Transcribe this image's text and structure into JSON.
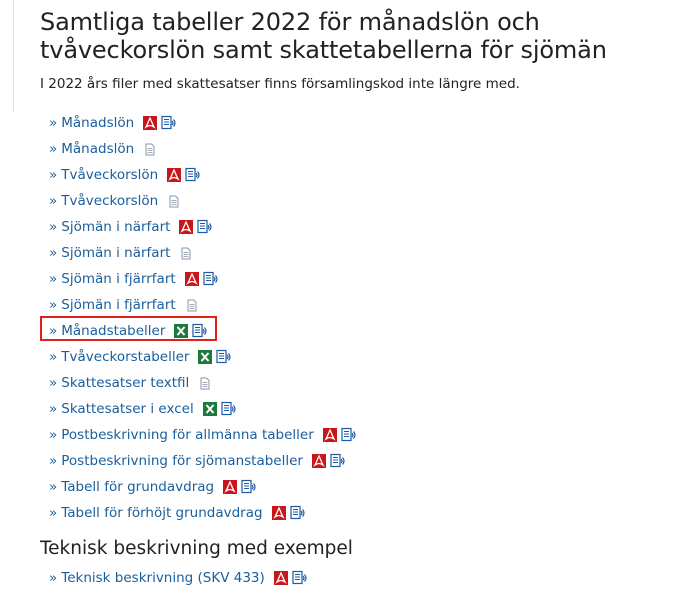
{
  "page": {
    "title": "Samtliga tabeller 2022 för månadslön och tvåveckorslön samt skattetabellerna för sjömän",
    "intro": "I 2022 års filer med skattesatser finns församlingskod inte längre med."
  },
  "colors": {
    "link": "#1a5f9c",
    "highlight": "#e0201b",
    "pdf": "#c8161d",
    "excel": "#1e7a3c",
    "accessible": "#1f5aa6"
  },
  "links": [
    {
      "text": "Månadslön",
      "icons": [
        "pdf-icon",
        "accessible-document-icon"
      ]
    },
    {
      "text": "Månadslön",
      "icons": [
        "text-file-icon"
      ]
    },
    {
      "text": "Tvåveckorslön",
      "icons": [
        "pdf-icon",
        "accessible-document-icon"
      ]
    },
    {
      "text": "Tvåveckorslön",
      "icons": [
        "text-file-icon"
      ]
    },
    {
      "text": "Sjömän i närfart",
      "icons": [
        "pdf-icon",
        "accessible-document-icon"
      ]
    },
    {
      "text": "Sjömän i närfart",
      "icons": [
        "text-file-icon"
      ]
    },
    {
      "text": "Sjömän i fjärrfart",
      "icons": [
        "pdf-icon",
        "accessible-document-icon"
      ]
    },
    {
      "text": "Sjömän i fjärrfart",
      "icons": [
        "text-file-icon"
      ]
    },
    {
      "text": "Månadstabeller",
      "icons": [
        "excel-icon",
        "accessible-document-icon"
      ],
      "highlighted": true
    },
    {
      "text": "Tvåveckorstabeller",
      "icons": [
        "excel-icon",
        "accessible-document-icon"
      ]
    },
    {
      "text": "Skattesatser textfil",
      "icons": [
        "text-file-icon"
      ]
    },
    {
      "text": "Skattesatser i excel",
      "icons": [
        "excel-icon",
        "accessible-document-icon"
      ]
    },
    {
      "text": "Postbeskrivning för allmänna tabeller",
      "icons": [
        "pdf-icon",
        "accessible-document-icon"
      ]
    },
    {
      "text": "Postbeskrivning för sjömanstabeller",
      "icons": [
        "pdf-icon",
        "accessible-document-icon"
      ]
    },
    {
      "text": "Tabell för grundavdrag",
      "icons": [
        "pdf-icon",
        "accessible-document-icon"
      ]
    },
    {
      "text": "Tabell för förhöjt grundavdrag",
      "icons": [
        "pdf-icon",
        "accessible-document-icon"
      ]
    }
  ],
  "section2": {
    "title": "Teknisk beskrivning med exempel",
    "links": [
      {
        "text": "Teknisk beskrivning (SKV 433)",
        "icons": [
          "pdf-icon",
          "accessible-document-icon"
        ]
      }
    ]
  },
  "bullet": "»"
}
